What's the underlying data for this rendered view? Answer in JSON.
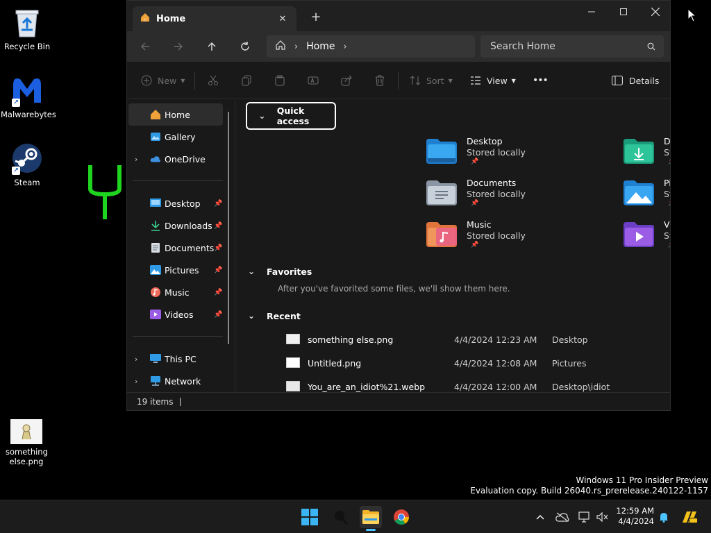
{
  "desktop": {
    "icons": [
      {
        "label": "Recycle Bin"
      },
      {
        "label": "Malwarebytes"
      },
      {
        "label": "Steam"
      },
      {
        "label": "something else.png"
      }
    ]
  },
  "explorer": {
    "tab_title": "Home",
    "breadcrumb": {
      "current": "Home"
    },
    "search": {
      "placeholder": "Search Home"
    },
    "toolbar": {
      "new_label": "New",
      "sort_label": "Sort",
      "view_label": "View",
      "more_label": "•••",
      "details_label": "Details"
    },
    "sidebar": {
      "top": [
        {
          "label": "Home"
        },
        {
          "label": "Gallery"
        },
        {
          "label": "OneDrive"
        }
      ],
      "pinned": [
        {
          "label": "Desktop"
        },
        {
          "label": "Downloads"
        },
        {
          "label": "Documents"
        },
        {
          "label": "Pictures"
        },
        {
          "label": "Music"
        },
        {
          "label": "Videos"
        }
      ],
      "bottom": [
        {
          "label": "This PC"
        },
        {
          "label": "Network"
        }
      ]
    },
    "quick_access": {
      "title": "Quick access",
      "items": [
        {
          "name": "Desktop",
          "sub": "Stored locally"
        },
        {
          "name": "Downloads",
          "sub": "Stored locally"
        },
        {
          "name": "Documents",
          "sub": "Stored locally"
        },
        {
          "name": "Pictures",
          "sub": "Stored locally"
        },
        {
          "name": "Music",
          "sub": "Stored locally"
        },
        {
          "name": "Videos",
          "sub": "Stored locally"
        }
      ]
    },
    "favorites": {
      "title": "Favorites",
      "note": "After you've favorited some files, we'll show them here."
    },
    "recent": {
      "title": "Recent",
      "rows": [
        {
          "name": "something else.png",
          "date": "4/4/2024 12:23 AM",
          "location": "Desktop"
        },
        {
          "name": "Untitled.png",
          "date": "4/4/2024 12:08 AM",
          "location": "Pictures"
        },
        {
          "name": "You_are_an_idiot%21.webp",
          "date": "4/4/2024 12:00 AM",
          "location": "Desktop\\idiot"
        }
      ]
    },
    "status": {
      "count": "19 items"
    }
  },
  "watermark": {
    "line1": "Windows 11 Pro Insider Preview",
    "line2": "Evaluation copy. Build 26040.rs_prerelease.240122-1157"
  },
  "taskbar": {
    "time": "12:59 AM",
    "date": "4/4/2024"
  },
  "colors": {
    "accent": "#4cc2ff",
    "window_bg": "#191919",
    "folder_blue": "#2f9be6"
  }
}
